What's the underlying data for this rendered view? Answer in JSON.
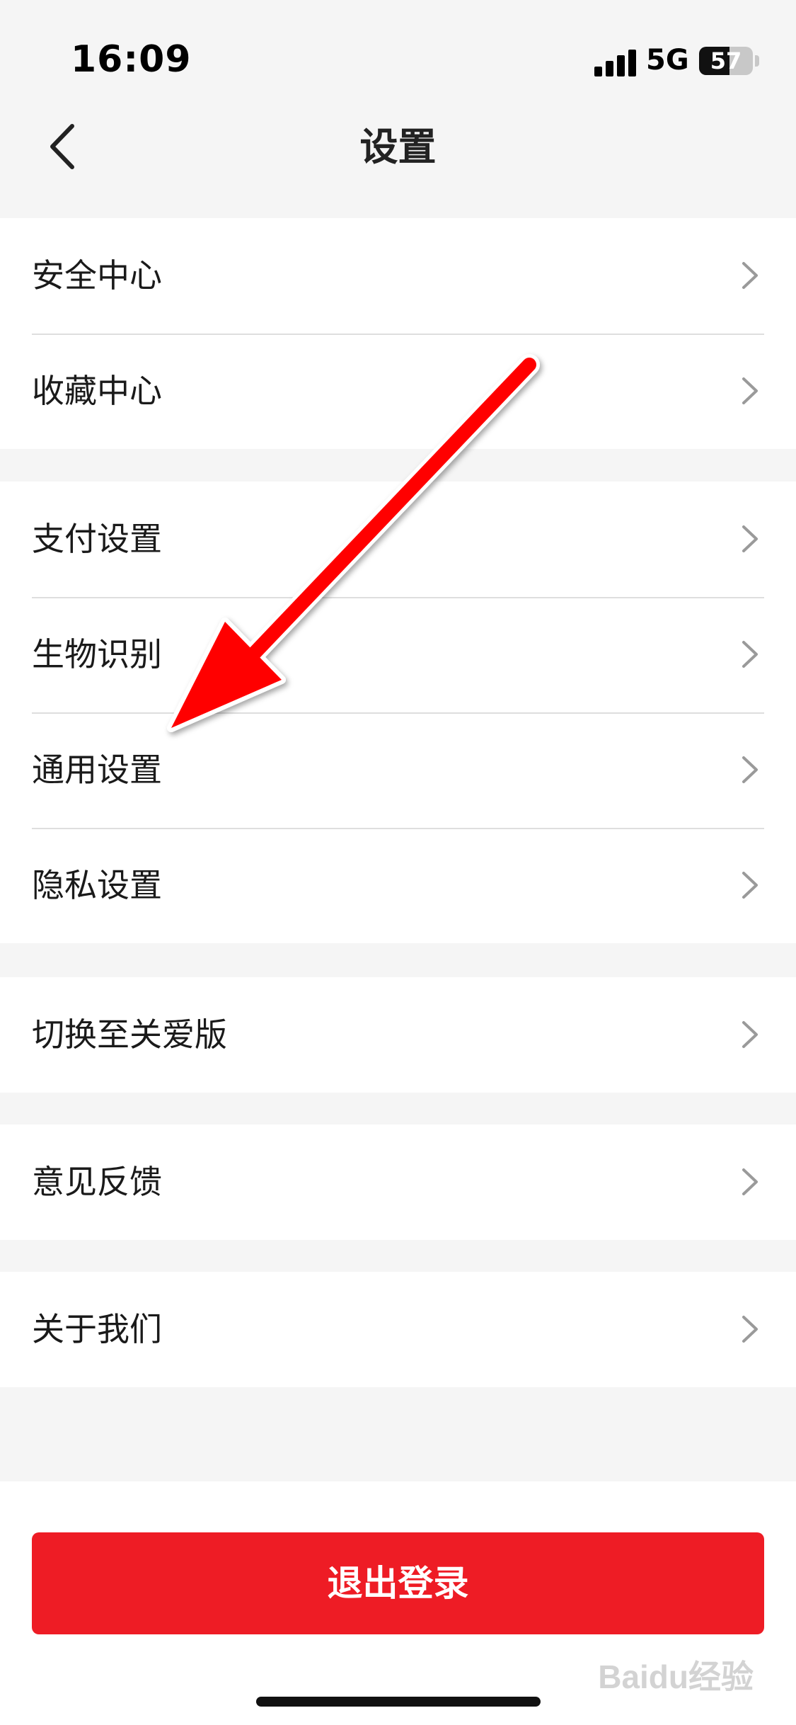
{
  "status_bar": {
    "time": "16:09",
    "network": "5G",
    "battery": "57",
    "battery_level": 0.57
  },
  "nav": {
    "title": "设置",
    "back_icon": "chevron-left-icon"
  },
  "menu": {
    "group1": [
      {
        "label": "安全中心"
      },
      {
        "label": "收藏中心"
      }
    ],
    "group2": [
      {
        "label": "支付设置"
      },
      {
        "label": "生物识别"
      },
      {
        "label": "通用设置"
      },
      {
        "label": "隐私设置"
      }
    ],
    "group3": [
      {
        "label": "切换至关爱版"
      }
    ],
    "group4": [
      {
        "label": "意见反馈"
      }
    ],
    "group5": [
      {
        "label": "关于我们"
      }
    ],
    "chevron_icon": "chevron-right-icon"
  },
  "logout": {
    "label": "退出登录"
  },
  "colors": {
    "accent": "#ee1c25",
    "background": "#f5f5f5",
    "arrow": "#ff0000"
  },
  "annotation": {
    "type": "arrow",
    "points_to": "通用设置"
  },
  "watermark": {
    "text": "Baidu经验"
  }
}
